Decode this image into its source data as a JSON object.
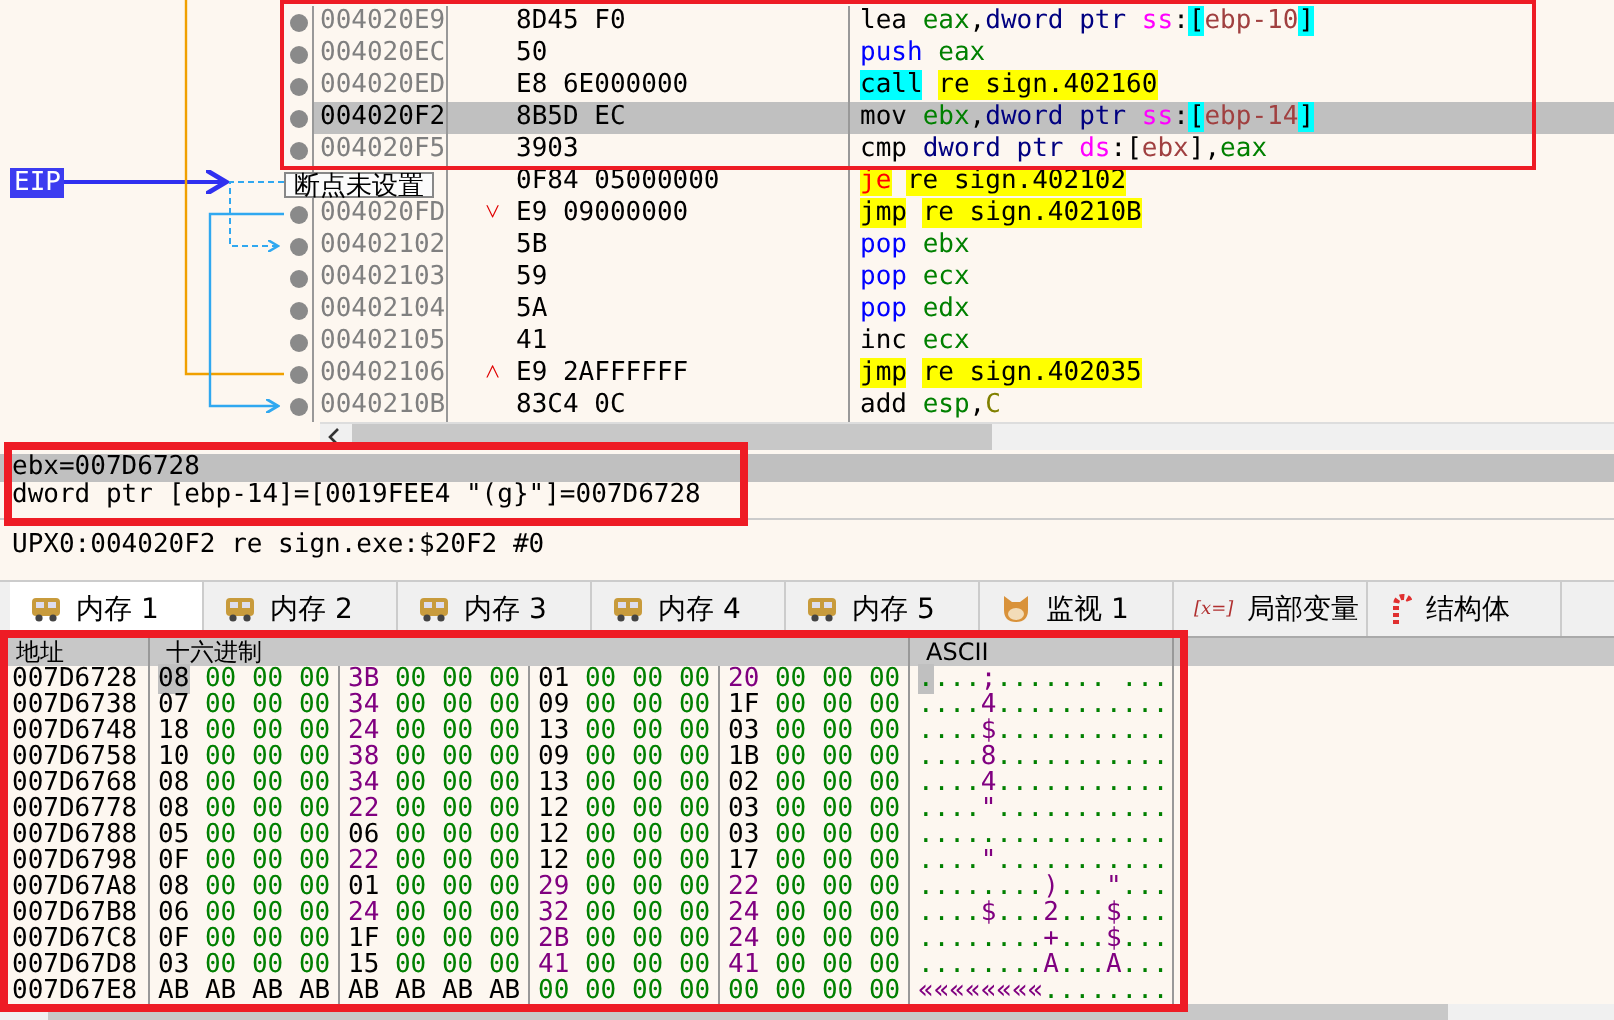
{
  "disassembly": {
    "eip_label": "EIP",
    "tooltip": "断点未设置",
    "rows": [
      {
        "address": "004020E9",
        "bytes": "8D45 F0",
        "selected": false,
        "mnemonic": {
          "kind": "mn",
          "text": "lea"
        },
        "operands": [
          {
            "kind": "reg",
            "text": "eax"
          },
          {
            "kind": "text",
            "text": ","
          },
          {
            "kind": "ptr",
            "text": "dword ptr "
          },
          {
            "kind": "seg",
            "text": "ss"
          },
          {
            "kind": "text",
            "text": ":"
          },
          {
            "kind": "memhl",
            "text": "[ebp-10]"
          }
        ]
      },
      {
        "address": "004020EC",
        "bytes": "50",
        "selected": false,
        "mnemonic": {
          "kind": "stack",
          "text": "push"
        },
        "operands": [
          {
            "kind": "reg",
            "text": "eax"
          }
        ]
      },
      {
        "address": "004020ED",
        "bytes": "E8 6E000000",
        "selected": false,
        "mnemonic": {
          "kind": "call",
          "text": "call"
        },
        "operands": [
          {
            "kind": "target",
            "text": "re sign.402160"
          }
        ]
      },
      {
        "address": "004020F2",
        "bytes": "8B5D EC",
        "selected": true,
        "mnemonic": {
          "kind": "mn",
          "text": "mov"
        },
        "operands": [
          {
            "kind": "reg",
            "text": "ebx"
          },
          {
            "kind": "text",
            "text": ","
          },
          {
            "kind": "ptr",
            "text": "dword ptr "
          },
          {
            "kind": "seg",
            "text": "ss"
          },
          {
            "kind": "text",
            "text": ":"
          },
          {
            "kind": "memhl",
            "text": "[ebp-14]"
          }
        ]
      },
      {
        "address": "004020F5",
        "bytes": "3903",
        "selected": false,
        "mnemonic": {
          "kind": "mn",
          "text": "cmp"
        },
        "operands": [
          {
            "kind": "ptr",
            "text": "dword ptr "
          },
          {
            "kind": "seg",
            "text": "ds"
          },
          {
            "kind": "text",
            "text": ":"
          },
          {
            "kind": "mem",
            "text": "[ebx]"
          },
          {
            "kind": "text",
            "text": ","
          },
          {
            "kind": "reg",
            "text": "eax"
          }
        ]
      },
      {
        "bytes": "0F84 05000000",
        "selected": false,
        "mnemonic": {
          "kind": "jcc",
          "text": "je"
        },
        "operands": [
          {
            "kind": "target",
            "text": "re sign.402102"
          }
        ]
      },
      {
        "address": "004020FD",
        "bytes": "E9 09000000",
        "marker": "˅",
        "selected": false,
        "mnemonic": {
          "kind": "jmp",
          "text": "jmp"
        },
        "operands": [
          {
            "kind": "target",
            "text": "re sign.40210B"
          }
        ]
      },
      {
        "address": "00402102",
        "bytes": "5B",
        "selected": false,
        "mnemonic": {
          "kind": "stack",
          "text": "pop"
        },
        "operands": [
          {
            "kind": "reg",
            "text": "ebx"
          }
        ]
      },
      {
        "address": "00402103",
        "bytes": "59",
        "selected": false,
        "mnemonic": {
          "kind": "stack",
          "text": "pop"
        },
        "operands": [
          {
            "kind": "reg",
            "text": "ecx"
          }
        ]
      },
      {
        "address": "00402104",
        "bytes": "5A",
        "selected": false,
        "mnemonic": {
          "kind": "stack",
          "text": "pop"
        },
        "operands": [
          {
            "kind": "reg",
            "text": "edx"
          }
        ]
      },
      {
        "address": "00402105",
        "bytes": "41",
        "selected": false,
        "mnemonic": {
          "kind": "mn",
          "text": "inc"
        },
        "operands": [
          {
            "kind": "reg",
            "text": "ecx"
          }
        ]
      },
      {
        "address": "00402106",
        "bytes": "E9 2AFFFFFF",
        "marker": "˄",
        "selected": false,
        "mnemonic": {
          "kind": "jmp",
          "text": "jmp"
        },
        "operands": [
          {
            "kind": "target",
            "text": "re sign.402035"
          }
        ]
      },
      {
        "address": "0040210B",
        "bytes": "83C4 0C",
        "selected": false,
        "mnemonic": {
          "kind": "mn",
          "text": "add"
        },
        "operands": [
          {
            "kind": "reg",
            "text": "esp"
          },
          {
            "kind": "text",
            "text": ","
          },
          {
            "kind": "num",
            "text": "C"
          }
        ]
      }
    ]
  },
  "info": {
    "lines": [
      {
        "text": "ebx=007D6728",
        "selected": true
      },
      {
        "text": "dword ptr [ebp-14]=[0019FEE4 \"(g}\"]=007D6728",
        "selected": false
      }
    ],
    "location": "UPX0:004020F2 re sign.exe:$20F2 #0"
  },
  "tabs": [
    {
      "label": "内存 1",
      "kind": "memory",
      "selected": true
    },
    {
      "label": "内存 2",
      "kind": "memory",
      "selected": false
    },
    {
      "label": "内存 3",
      "kind": "memory",
      "selected": false
    },
    {
      "label": "内存 4",
      "kind": "memory",
      "selected": false
    },
    {
      "label": "内存 5",
      "kind": "memory",
      "selected": false
    },
    {
      "label": "监视 1",
      "kind": "watch",
      "selected": false
    },
    {
      "label": "局部变量",
      "kind": "locals",
      "icon_text": "[x=]",
      "selected": false
    },
    {
      "label": "结构体",
      "kind": "struct",
      "selected": false
    }
  ],
  "hexdump": {
    "columns": {
      "address": "地址",
      "hex": "十六进制",
      "ascii": "ASCII"
    },
    "rows": [
      {
        "address": "007D6728",
        "groups": [
          "08 00 00 00",
          "3B 00 00 00",
          "01 00 00 00",
          "20 00 00 00"
        ],
        "ascii": "....;....... ...",
        "selected": true
      },
      {
        "address": "007D6738",
        "groups": [
          "07 00 00 00",
          "34 00 00 00",
          "09 00 00 00",
          "1F 00 00 00"
        ],
        "ascii": "....4...........",
        "selected": false
      },
      {
        "address": "007D6748",
        "groups": [
          "18 00 00 00",
          "24 00 00 00",
          "13 00 00 00",
          "03 00 00 00"
        ],
        "ascii": "....$...........",
        "selected": false
      },
      {
        "address": "007D6758",
        "groups": [
          "10 00 00 00",
          "38 00 00 00",
          "09 00 00 00",
          "1B 00 00 00"
        ],
        "ascii": "....8...........",
        "selected": false
      },
      {
        "address": "007D6768",
        "groups": [
          "08 00 00 00",
          "34 00 00 00",
          "13 00 00 00",
          "02 00 00 00"
        ],
        "ascii": "....4...........",
        "selected": false
      },
      {
        "address": "007D6778",
        "groups": [
          "08 00 00 00",
          "22 00 00 00",
          "12 00 00 00",
          "03 00 00 00"
        ],
        "ascii": "....\"...........",
        "selected": false
      },
      {
        "address": "007D6788",
        "groups": [
          "05 00 00 00",
          "06 00 00 00",
          "12 00 00 00",
          "03 00 00 00"
        ],
        "ascii": "................",
        "selected": false
      },
      {
        "address": "007D6798",
        "groups": [
          "0F 00 00 00",
          "22 00 00 00",
          "12 00 00 00",
          "17 00 00 00"
        ],
        "ascii": "....\"...........",
        "selected": false
      },
      {
        "address": "007D67A8",
        "groups": [
          "08 00 00 00",
          "01 00 00 00",
          "29 00 00 00",
          "22 00 00 00"
        ],
        "ascii": "........)...\"...",
        "selected": false
      },
      {
        "address": "007D67B8",
        "groups": [
          "06 00 00 00",
          "24 00 00 00",
          "32 00 00 00",
          "24 00 00 00"
        ],
        "ascii": "....$...2...$...",
        "selected": false
      },
      {
        "address": "007D67C8",
        "groups": [
          "0F 00 00 00",
          "1F 00 00 00",
          "2B 00 00 00",
          "24 00 00 00"
        ],
        "ascii": "........+...$...",
        "selected": false
      },
      {
        "address": "007D67D8",
        "groups": [
          "03 00 00 00",
          "15 00 00 00",
          "41 00 00 00",
          "41 00 00 00"
        ],
        "ascii": "........A...A...",
        "selected": false
      },
      {
        "address": "007D67E8",
        "groups": [
          "AB AB AB AB",
          "AB AB AB AB",
          "00 00 00 00",
          "00 00 00 00"
        ],
        "ascii": "««««««««........",
        "selected": false
      }
    ]
  }
}
